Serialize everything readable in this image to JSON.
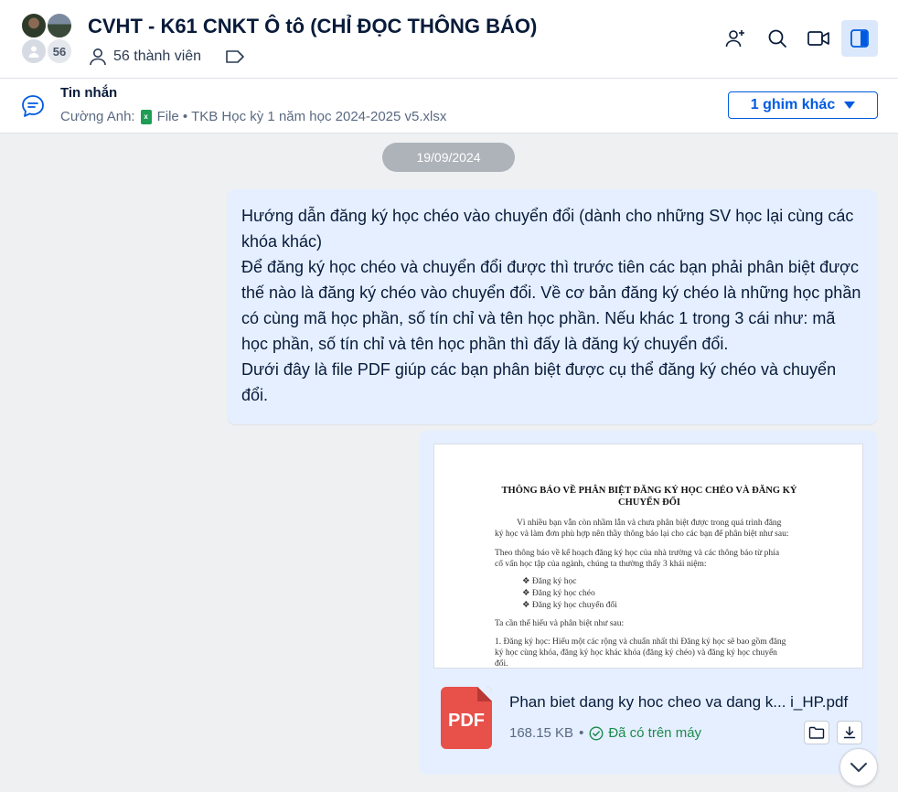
{
  "header": {
    "title": "CVHT - K61 CNKT Ô tô (CHỈ ĐỌC THÔNG BÁO)",
    "member_count_badge": "56",
    "members_label": "56 thành viên"
  },
  "pinned": {
    "title": "Tin nhắn",
    "sender": "Cường Anh:",
    "content": "File • TKB Học kỳ 1 năm học 2024-2025 v5.xlsx",
    "more_button": "1 ghim khác"
  },
  "date_chip": "19/09/2024",
  "message": {
    "paragraphs": [
      "Hướng dẫn đăng ký học chéo vào chuyển đổi (dành cho những SV học lại cùng các khóa khác)",
      "Để đăng ký học chéo và chuyển đổi được thì trước tiên các bạn phải phân biệt được thế nào là đăng ký chéo vào chuyển đổi. Về cơ bản đăng ký chéo là những học phần có cùng mã học phần, số tín chỉ và tên học phần. Nếu khác 1 trong 3 cái như: mã học phần, số tín chỉ và tên học phần thì đấy là đăng ký chuyển đổi.",
      "Dưới đây là file PDF giúp các bạn phân biệt được cụ thể đăng ký chéo và chuyển đổi."
    ]
  },
  "file": {
    "preview": {
      "title": "THÔNG BÁO VỀ PHÂN BIỆT ĐĂNG KÝ HỌC CHÉO VÀ ĐĂNG KÝ CHUYỂN ĐỔI",
      "lines": [
        "Vì nhiều bạn vẫn còn nhầm lẫn và chưa phân biệt được trong quá trình đăng",
        "ký học và làm đơn phù hợp nên thầy thông báo lại cho các bạn để phân biệt như sau:",
        "Theo thông báo về kế hoạch đăng ký học của nhà trường và các thông báo từ phía",
        "cố vấn học tập của ngành, chúng ta thường thấy 3 khái niệm:",
        "❖  Đăng ký học",
        "❖  Đăng ký học chéo",
        "❖  Đăng ký học chuyển đổi",
        "Ta cần thể hiểu và phân biệt như sau:",
        "1. Đăng ký học: Hiểu một các rộng và chuẩn nhất thì Đăng ký học sẽ bao gồm đăng",
        "ký học cùng khóa, đăng ký học khác khóa (đăng ký chéo) và đăng ký học chuyển",
        "đổi."
      ]
    },
    "icon_label": "PDF",
    "name": "Phan biet dang ky hoc cheo va dang k... i_HP.pdf",
    "size": "168.15 KB",
    "separator": "•",
    "status": "Đã có trên máy"
  },
  "colors": {
    "accent": "#005ae0",
    "bubble": "#e5efff",
    "status_green": "#1c8a4c",
    "pdf_red": "#e8504a"
  }
}
